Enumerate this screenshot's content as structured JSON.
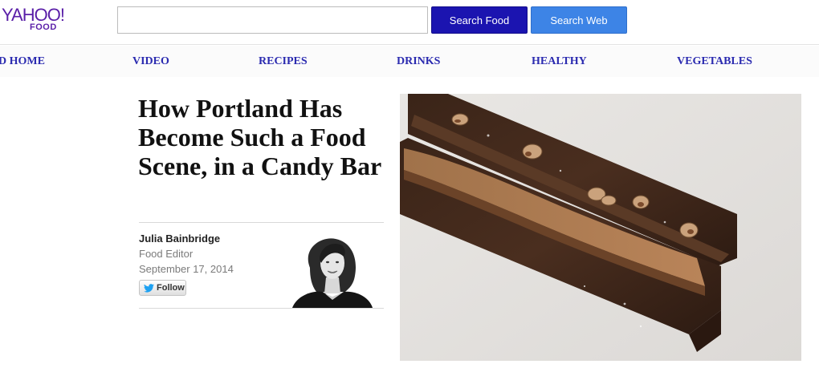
{
  "header": {
    "logo_text": "YAHOO!",
    "logo_sub": "FOOD",
    "search_value": "",
    "search_food_label": "Search Food",
    "search_web_label": "Search Web"
  },
  "nav": {
    "items": [
      "D HOME",
      "VIDEO",
      "RECIPES",
      "DRINKS",
      "HEALTHY",
      "VEGETABLES"
    ]
  },
  "article": {
    "title": "How Portland Has Become Such a Food Scene, in a Candy Bar",
    "author": "Julia Bainbridge",
    "role": "Food Editor",
    "date": "September 17, 2014",
    "follow_label": "Follow"
  },
  "colors": {
    "brand": "#5a1fa8",
    "nav_text": "#2b2bb0",
    "search_food_btn": "#1b14b0",
    "search_web_btn": "#3d84e6"
  },
  "icons": [
    "twitter-bird-icon"
  ]
}
